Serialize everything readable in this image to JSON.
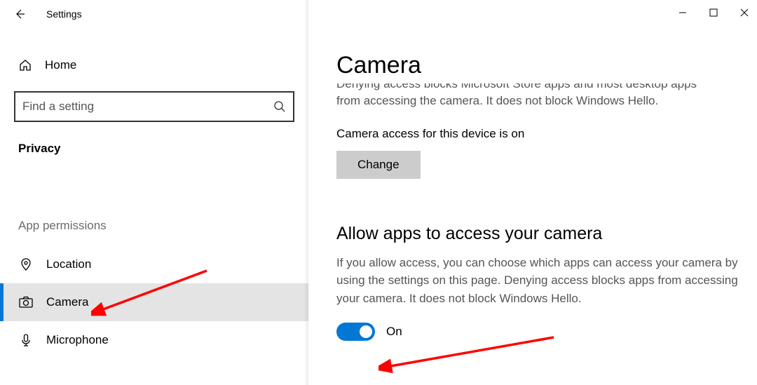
{
  "titlebar": {
    "title": "Settings"
  },
  "sidebar": {
    "home_label": "Home",
    "search_placeholder": "Find a setting",
    "section_header": "Privacy",
    "group_label": "App permissions",
    "items": [
      {
        "label": "Location",
        "icon": "location-icon",
        "selected": false
      },
      {
        "label": "Camera",
        "icon": "camera-icon",
        "selected": true
      },
      {
        "label": "Microphone",
        "icon": "microphone-icon",
        "selected": false
      }
    ]
  },
  "content": {
    "page_title": "Camera",
    "truncated_top": "Denying access blocks Microsoft Store apps and most desktop apps",
    "truncated_line2": "from accessing the camera. It does not block Windows Hello.",
    "device_access_status": "Camera access for this device is on",
    "change_button": "Change",
    "allow_apps_heading": "Allow apps to access your camera",
    "allow_apps_description": "If you allow access, you can choose which apps can access your camera by using the settings on this page. Denying access blocks apps from accessing your camera. It does not block Windows Hello.",
    "toggle_state": "On",
    "toggle_on": true
  },
  "colors": {
    "accent": "#0078d4",
    "annotation": "#ff0000"
  }
}
